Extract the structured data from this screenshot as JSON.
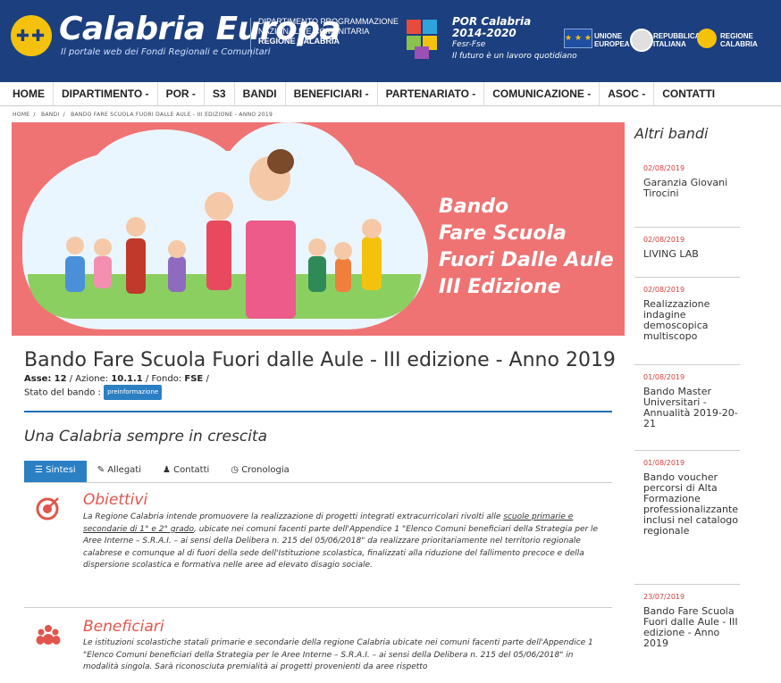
{
  "header": {
    "brand": "Calabria Europa",
    "brand_sub": "Il portale web dei Fondi Regionali e Comunitari",
    "dept_lines": [
      "DIPARTIMENTO PROGRAMMAZIONE",
      "NAZIONALE E COMUNITARIA",
      "REGIONE CALABRIA"
    ],
    "por_title": "POR Calabria",
    "por_years": "2014-2020",
    "por_fund": "Fesr-Fse",
    "por_tagline": "Il futuro è un lavoro quotidiano",
    "ue": [
      "UNIONE",
      "EUROPEA"
    ],
    "repubblica": [
      "REPUBBLICA",
      "ITALIANA"
    ],
    "regione": [
      "REGIONE",
      "CALABRIA"
    ],
    "colors": {
      "bar": "#1c3f7f",
      "accent": "#f4c20d"
    }
  },
  "nav": [
    "HOME",
    "DIPARTIMENTO -",
    "POR -",
    "S3",
    "BANDI",
    "BENEFICIARI -",
    "PARTENARIATO -",
    "COMUNICAZIONE -",
    "ASOC -",
    "CONTATTI"
  ],
  "breadcrumb": [
    "HOME",
    "BANDI",
    "BANDO FARE SCUOLA FUORI DALLE AULE - III EDIZIONE - ANNO 2019"
  ],
  "banner": {
    "lines": [
      "Bando",
      "Fare Scuola",
      "Fuori Dalle Aule",
      "III Edizione"
    ],
    "bg": "#ef7373"
  },
  "page": {
    "title": "Bando Fare Scuola Fuori dalle Aule - III edizione - Anno 2019",
    "asse_label": "Asse:",
    "asse": "12",
    "azione_label": "/ Azione:",
    "azione": "10.1.1",
    "fondo_label": "/ Fondo:",
    "fondo": "FSE",
    "fondo_end": "/",
    "stato_label": "Stato del bando :",
    "stato": "preinformazione",
    "subtitle": "Una Calabria sempre in crescita"
  },
  "tabs": [
    {
      "icon": "list-icon",
      "label": "Sintesi",
      "glyph": "☰"
    },
    {
      "icon": "paperclip-icon",
      "label": "Allegati",
      "glyph": "✎"
    },
    {
      "icon": "person-icon",
      "label": "Contatti",
      "glyph": "♟"
    },
    {
      "icon": "clock-icon",
      "label": "Cronologia",
      "glyph": "◷"
    }
  ],
  "sections": {
    "obiettivi": {
      "title": "Obiettivi",
      "text_a": "La Regione Calabria intende promuovere la realizzazione di progetti integrati extracurricolari rivolti alle ",
      "text_link": "scuole primarie e secondarie di 1° e 2° grado",
      "text_b": ", ubicate nei comuni facenti parte dell'Appendice 1 \"Elenco Comuni beneficiari della Strategia per le Aree Interne – S.R.A.I. – ai sensi della Delibera n. 215 del 05/06/2018\" da realizzare prioritariamente nel territorio regionale calabrese e comunque al di fuori della sede dell'Istituzione scolastica, finalizzati alla riduzione del fallimento precoce e della dispersione scolastica e formativa nelle aree ad elevato disagio sociale."
    },
    "beneficiari": {
      "title": "Beneficiari",
      "text": "Le istituzioni scolastiche statali primarie e secondarie della regione Calabria ubicate nei comuni facenti parte dell'Appendice 1 \"Elenco Comuni beneficiari della Strategia per le Aree Interne – S.R.A.I. – ai sensi della Delibera n. 215 del 05/06/2018\" in modalità singola. Sarà riconosciuta premialità ai progetti provenienti da aree rispetto"
    }
  },
  "sidebar": {
    "title": "Altri bandi",
    "items": [
      {
        "date": "02/08/2019",
        "name": "Garanzia Giovani Tirocini"
      },
      {
        "date": "02/08/2019",
        "name": "LIVING LAB"
      },
      {
        "date": "02/08/2019",
        "name": "Realizzazione indagine demoscopica multiscopo"
      },
      {
        "date": "01/08/2019",
        "name": "Bando Master Universitari - Annualità 2019-20-21"
      },
      {
        "date": "01/08/2019",
        "name": "Bando voucher percorsi di Alta Formazione professionalizzante inclusi nel catalogo regionale"
      },
      {
        "date": "23/07/2019",
        "name": "Bando Fare Scuola Fuori dalle Aule - III edizione - Anno 2019"
      }
    ]
  }
}
